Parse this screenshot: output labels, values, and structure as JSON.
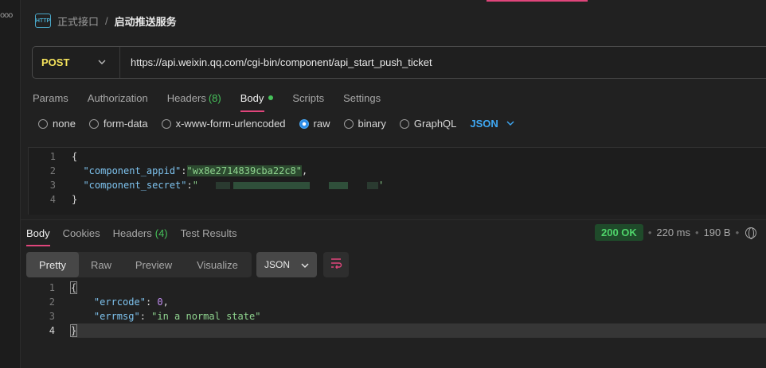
{
  "breadcrumb": {
    "icon": "http-icon",
    "icon_text": "HTTP",
    "parent": "正式接口",
    "separator": "/",
    "current": "启动推送服务"
  },
  "request": {
    "method": "POST",
    "url": "https://api.weixin.qq.com/cgi-bin/component/api_start_push_ticket",
    "tabs": [
      {
        "label": "Params"
      },
      {
        "label": "Authorization"
      },
      {
        "label": "Headers",
        "count": "(8)"
      },
      {
        "label": "Body",
        "active": true
      },
      {
        "label": "Scripts"
      },
      {
        "label": "Settings"
      }
    ],
    "body_types": [
      "none",
      "form-data",
      "x-www-form-urlencoded",
      "raw",
      "binary",
      "GraphQL"
    ],
    "body_type_selected": "raw",
    "body_format": "JSON",
    "body_lines": {
      "l1": "{",
      "l2_key": "\"component_appid\"",
      "l2_colon": ":",
      "l2_value": "\"wx8e2714839cba22c8\"",
      "l2_comma": ",",
      "l3_key": "\"component_secret\"",
      "l3_colon": ":",
      "l3_value_start": "\"",
      "l3_value_end": "'",
      "l4": "}"
    }
  },
  "response": {
    "tabs": [
      {
        "label": "Body",
        "active": true
      },
      {
        "label": "Cookies"
      },
      {
        "label": "Headers",
        "count": "(4)"
      },
      {
        "label": "Test Results"
      }
    ],
    "status": "200 OK",
    "time": "220 ms",
    "size": "190 B",
    "views": [
      "Pretty",
      "Raw",
      "Preview",
      "Visualize"
    ],
    "view_selected": "Pretty",
    "format": "JSON",
    "lines": {
      "l1": "{",
      "l2_key": "\"errcode\"",
      "l2_colon": ": ",
      "l2_value": "0",
      "l2_comma": ",",
      "l3_key": "\"errmsg\"",
      "l3_colon": ": ",
      "l3_value": "\"in a normal state\"",
      "l4": "}"
    }
  },
  "line_numbers": [
    "1",
    "2",
    "3",
    "4"
  ],
  "colors": {
    "accent": "#e0457b",
    "method": "#f5e35c",
    "status_ok": "#4fd46a",
    "json_select": "#3fa9f5"
  }
}
